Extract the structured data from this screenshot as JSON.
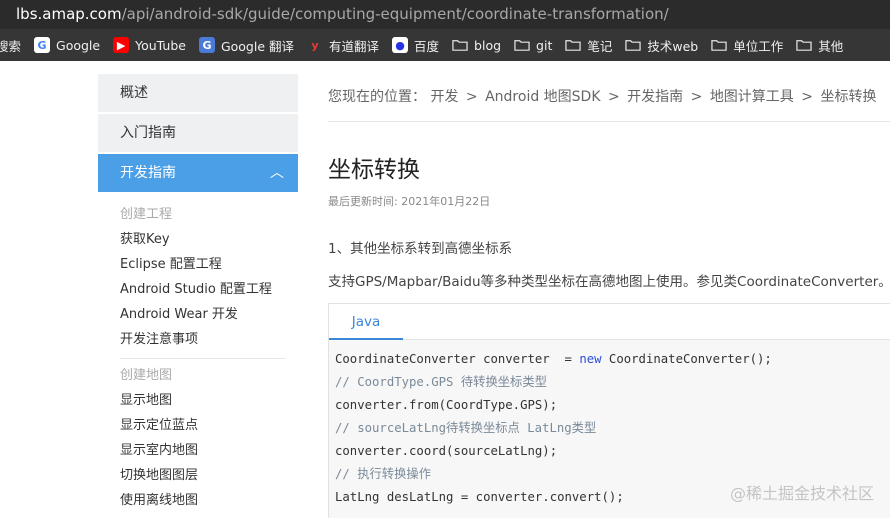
{
  "url": {
    "host": "lbs.amap.com",
    "path": "/api/android-sdk/guide/computing-equipment/coordinate-transformation/"
  },
  "bookmarks": [
    {
      "label": "搜索",
      "icon": "none"
    },
    {
      "label": "Google",
      "icon": "google-icon"
    },
    {
      "label": "YouTube",
      "icon": "youtube-icon"
    },
    {
      "label": "Google 翻译",
      "icon": "google-translate-icon"
    },
    {
      "label": "有道翻译",
      "icon": "youdao-icon"
    },
    {
      "label": "百度",
      "icon": "baidu-icon"
    },
    {
      "label": "blog",
      "icon": "folder-icon"
    },
    {
      "label": "git",
      "icon": "folder-icon"
    },
    {
      "label": "笔记",
      "icon": "folder-icon"
    },
    {
      "label": "技术web",
      "icon": "folder-icon"
    },
    {
      "label": "单位工作",
      "icon": "folder-icon"
    },
    {
      "label": "其他",
      "icon": "folder-icon"
    }
  ],
  "sidebar": {
    "overview": "概述",
    "getting_started": "入门指南",
    "dev_guide": "开发指南",
    "chevron": "︿",
    "groups": [
      {
        "category": "创建工程",
        "items": [
          "获取Key",
          "Eclipse 配置工程",
          "Android Studio 配置工程",
          "Android Wear 开发",
          "开发注意事项"
        ]
      },
      {
        "category": "创建地图",
        "items": [
          "显示地图",
          "显示定位蓝点",
          "显示室内地图",
          "切换地图图层",
          "使用离线地图"
        ]
      }
    ]
  },
  "breadcrumb": {
    "prefix": "您现在的位置：",
    "items": [
      "开发",
      "Android 地图SDK",
      "开发指南",
      "地图计算工具",
      "坐标转换"
    ],
    "separator": ">"
  },
  "article": {
    "title": "坐标转换",
    "updated": "最后更新时间: 2021年01月22日",
    "section": "1、其他坐标系转到高德坐标系",
    "description": "支持GPS/Mapbar/Baidu等多种类型坐标在高德地图上使用。参见类CoordinateConverter。",
    "code_tab": "Java",
    "code": {
      "l1_a": "CoordinateConverter converter  = ",
      "l1_kw": "new",
      "l1_b": " CoordinateConverter();",
      "l2": "// CoordType.GPS 待转换坐标类型",
      "l3": "converter.from(CoordType.GPS);",
      "l4": "// sourceLatLng待转换坐标点 LatLng类型",
      "l5": "converter.coord(sourceLatLng);",
      "l6": "// 执行转换操作",
      "l7": "LatLng desLatLng = converter.convert();"
    }
  },
  "watermark": "@稀土掘金技术社区",
  "colors": {
    "accent": "#4a9fe6",
    "tab": "#3a87d8",
    "keyword": "#2b4fd9"
  }
}
